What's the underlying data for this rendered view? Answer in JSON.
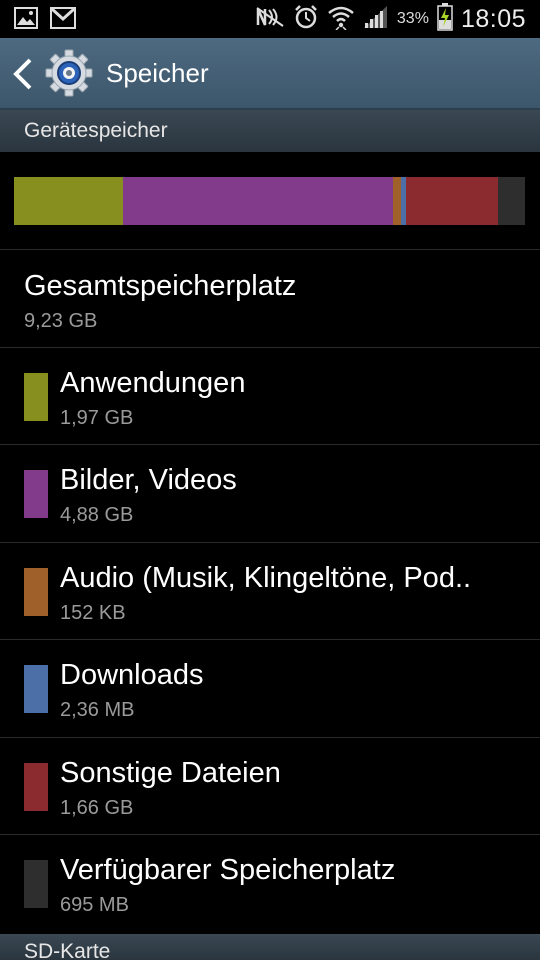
{
  "status_bar": {
    "left_icons": [
      "image-icon",
      "gmail-icon"
    ],
    "right_icons": [
      "nfc-icon",
      "alarm-icon",
      "wifi-icon",
      "signal-icon"
    ],
    "battery_percent": "33%",
    "time": "18:05"
  },
  "action_bar": {
    "title": "Speicher",
    "back_icon": "chevron-left-icon",
    "app_icon": "settings-gear-icon"
  },
  "device_storage": {
    "header": "Gerätespeicher",
    "usage_bar": [
      {
        "name": "Anwendungen",
        "color": "#87901f",
        "fraction": 0.2134
      },
      {
        "name": "Bilder, Videos",
        "color": "#823a8a",
        "fraction": 0.5287
      },
      {
        "name": "Audio",
        "color": "#a0602a",
        "fraction": 0.0147
      },
      {
        "name": "Downloads",
        "color": "#4c6fa8",
        "fraction": 0.0098
      },
      {
        "name": "Sonstige Dateien",
        "color": "#8b2b2f",
        "fraction": 0.1798
      },
      {
        "name": "Verfügbarer Speicherplatz",
        "color": "#2e2e2e",
        "fraction": 0.0536
      }
    ],
    "total": {
      "title": "Gesamtspeicherplatz",
      "value": "9,23 GB"
    },
    "items": [
      {
        "title": "Anwendungen",
        "value": "1,97 GB",
        "color": "#87901f"
      },
      {
        "title": "Bilder, Videos",
        "value": "4,88 GB",
        "color": "#823a8a"
      },
      {
        "title": "Audio (Musik, Klingeltöne, Pod..",
        "value": "152 KB",
        "color": "#a0602a"
      },
      {
        "title": "Downloads",
        "value": "2,36 MB",
        "color": "#4c6fa8"
      },
      {
        "title": "Sonstige Dateien",
        "value": "1,66 GB",
        "color": "#8b2b2f"
      },
      {
        "title": "Verfügbarer Speicherplatz",
        "value": "695 MB",
        "color": "#2e2e2e"
      }
    ]
  },
  "sd_card": {
    "header": "SD-Karte"
  }
}
